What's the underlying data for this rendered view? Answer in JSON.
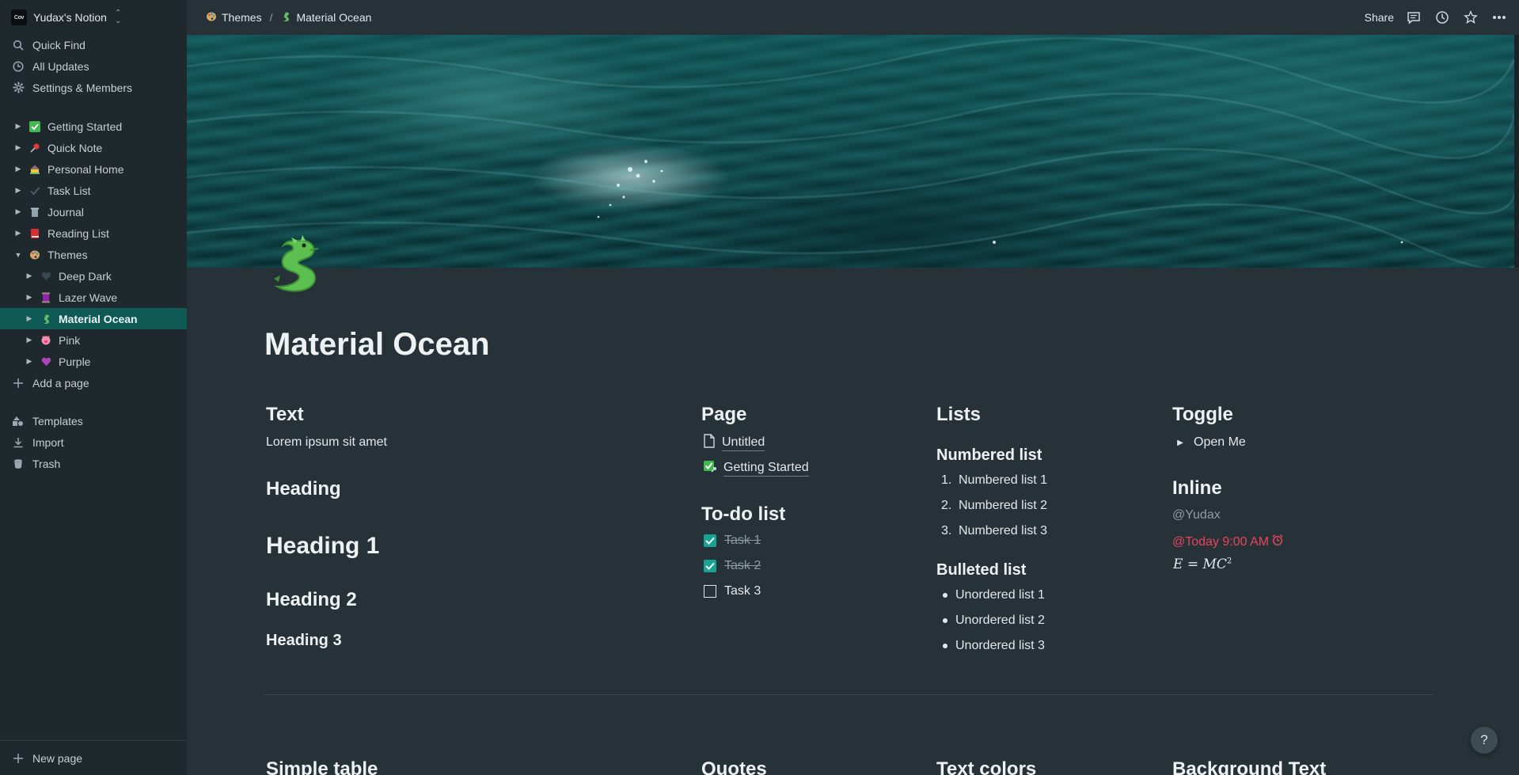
{
  "colors": {
    "sidebar_bg": "#1e282d",
    "page_bg": "#263238",
    "accent": "#0f5a55",
    "checkbox": "#16a394",
    "date_mention": "#e8445a"
  },
  "workspace": {
    "logo_text": "Cov",
    "name": "Yudax's Notion"
  },
  "sidebar": {
    "quick_find": "Quick Find",
    "all_updates": "All Updates",
    "settings": "Settings & Members",
    "pages": [
      {
        "label": "Getting Started",
        "emoji": "check-box-icon"
      },
      {
        "label": "Quick Note",
        "emoji": "pushpin-icon"
      },
      {
        "label": "Personal Home",
        "emoji": "house-icon"
      },
      {
        "label": "Task List",
        "emoji": "checkmark-icon"
      },
      {
        "label": "Journal",
        "emoji": "trash-bin-icon"
      },
      {
        "label": "Reading List",
        "emoji": "red-book-icon"
      },
      {
        "label": "Themes",
        "emoji": "palette-icon"
      }
    ],
    "theme_children": [
      {
        "label": "Deep Dark",
        "emoji": "black-heart-icon"
      },
      {
        "label": "Lazer Wave",
        "emoji": "thread-icon"
      },
      {
        "label": "Material Ocean",
        "emoji": "dragon-icon"
      },
      {
        "label": "Pink",
        "emoji": "pig-icon"
      },
      {
        "label": "Purple",
        "emoji": "purple-heart-icon"
      }
    ],
    "add_page": "Add a page",
    "templates": "Templates",
    "import": "Import",
    "trash": "Trash",
    "new_page": "New page"
  },
  "topbar": {
    "breadcrumb": [
      "Themes",
      "Material Ocean"
    ],
    "share": "Share"
  },
  "page": {
    "title": "Material Ocean",
    "text_col": {
      "heading": "Text",
      "body": "Lorem ipsum sit amet",
      "heading_plain": "Heading",
      "h1": "Heading 1",
      "h2": "Heading 2",
      "h3": "Heading 3"
    },
    "page_col": {
      "heading": "Page",
      "links": [
        "Untitled",
        "Getting Started"
      ],
      "todo_heading": "To-do list",
      "todos": [
        {
          "label": "Task 1",
          "checked": true
        },
        {
          "label": "Task 2",
          "checked": true
        },
        {
          "label": "Task 3",
          "checked": false
        }
      ]
    },
    "lists_col": {
      "heading": "Lists",
      "numbered_heading": "Numbered list",
      "numbered": [
        "Numbered list 1",
        "Numbered list 2",
        "Numbered list 3"
      ],
      "numbers": [
        "1.",
        "2.",
        "3."
      ],
      "bulleted_heading": "Bulleted list",
      "bulleted": [
        "Unordered list 1",
        "Unordered list 2",
        "Unordered list 3"
      ]
    },
    "toggle_col": {
      "heading": "Toggle",
      "toggle_label": "Open Me",
      "inline_heading": "Inline",
      "mention_user": "@Yudax",
      "mention_date": "@Today 9:00 AM",
      "equation_lhs": "E = MC",
      "equation_exp": "2"
    },
    "next_row": [
      "Simple table",
      "Quotes",
      "Text colors",
      "Background Text"
    ]
  },
  "help_label": "?"
}
